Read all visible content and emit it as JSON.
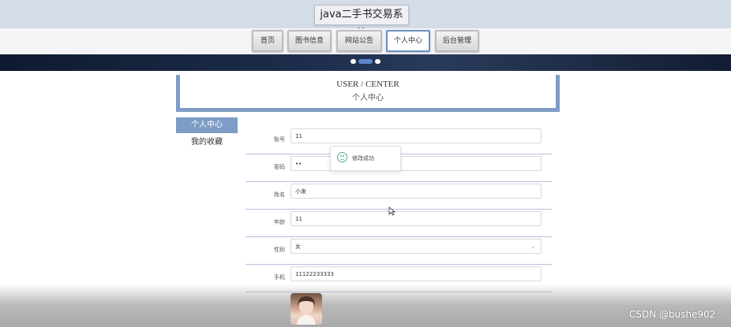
{
  "header": {
    "site_title": "java二手书交易系统"
  },
  "nav": {
    "items": [
      {
        "label": "首页"
      },
      {
        "label": "图书信息"
      },
      {
        "label": "网站公告"
      },
      {
        "label": "个人中心"
      },
      {
        "label": "后台管理"
      }
    ],
    "active_index": 3
  },
  "section": {
    "title_en": "USER / CENTER",
    "title_cn": "个人中心"
  },
  "sidebar": {
    "items": [
      {
        "label": "个人中心"
      },
      {
        "label": "我的收藏"
      }
    ]
  },
  "form": {
    "fields": [
      {
        "label": "账号",
        "value": "11"
      },
      {
        "label": "密码",
        "value": "••"
      },
      {
        "label": "姓名",
        "value": "小发"
      },
      {
        "label": "年龄",
        "value": "11"
      },
      {
        "label": "性别",
        "value": "女"
      },
      {
        "label": "手机",
        "value": "11122233333"
      }
    ]
  },
  "toast": {
    "message": "修改成功"
  },
  "watermark": "CSDN @bushe902",
  "colors": {
    "accent": "#7e9cc6",
    "success": "#4cae86"
  }
}
